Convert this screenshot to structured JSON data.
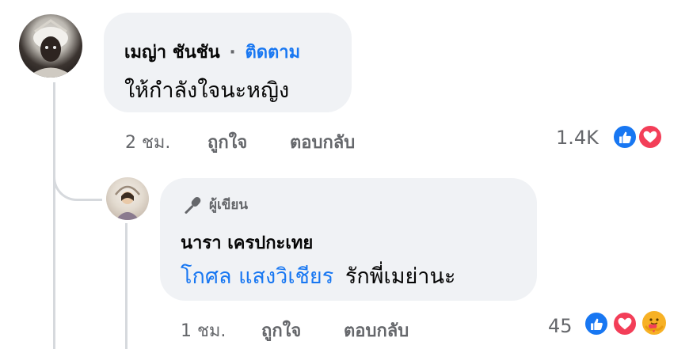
{
  "comment": {
    "author": "เมญ่า ชันชัน",
    "separator": "·",
    "follow_label": "ติดตาม",
    "text": "ให้กำลังใจนะหญิง",
    "time": "2 ชม.",
    "like_label": "ถูกใจ",
    "reply_label": "ตอบกลับ",
    "reaction_count": "1.4K",
    "reactions": [
      "like-icon",
      "love-icon"
    ]
  },
  "reply": {
    "badge_label": "ผู้เขียน",
    "author": "นารา เครปกะเทย",
    "mention": "โกศล แสงวิเชียร",
    "text": "รักพี่เมย่านะ",
    "time": "1 ชม.",
    "like_label": "ถูกใจ",
    "reply_label": "ตอบกลับ",
    "reaction_count": "45",
    "reactions": [
      "like-icon",
      "love-icon",
      "care-icon"
    ]
  },
  "colors": {
    "link": "#1877f2",
    "bubble": "#f0f2f5",
    "meta": "#65676b",
    "like": "#1877f2",
    "love": "#f33e58",
    "care": "#f7b125"
  }
}
